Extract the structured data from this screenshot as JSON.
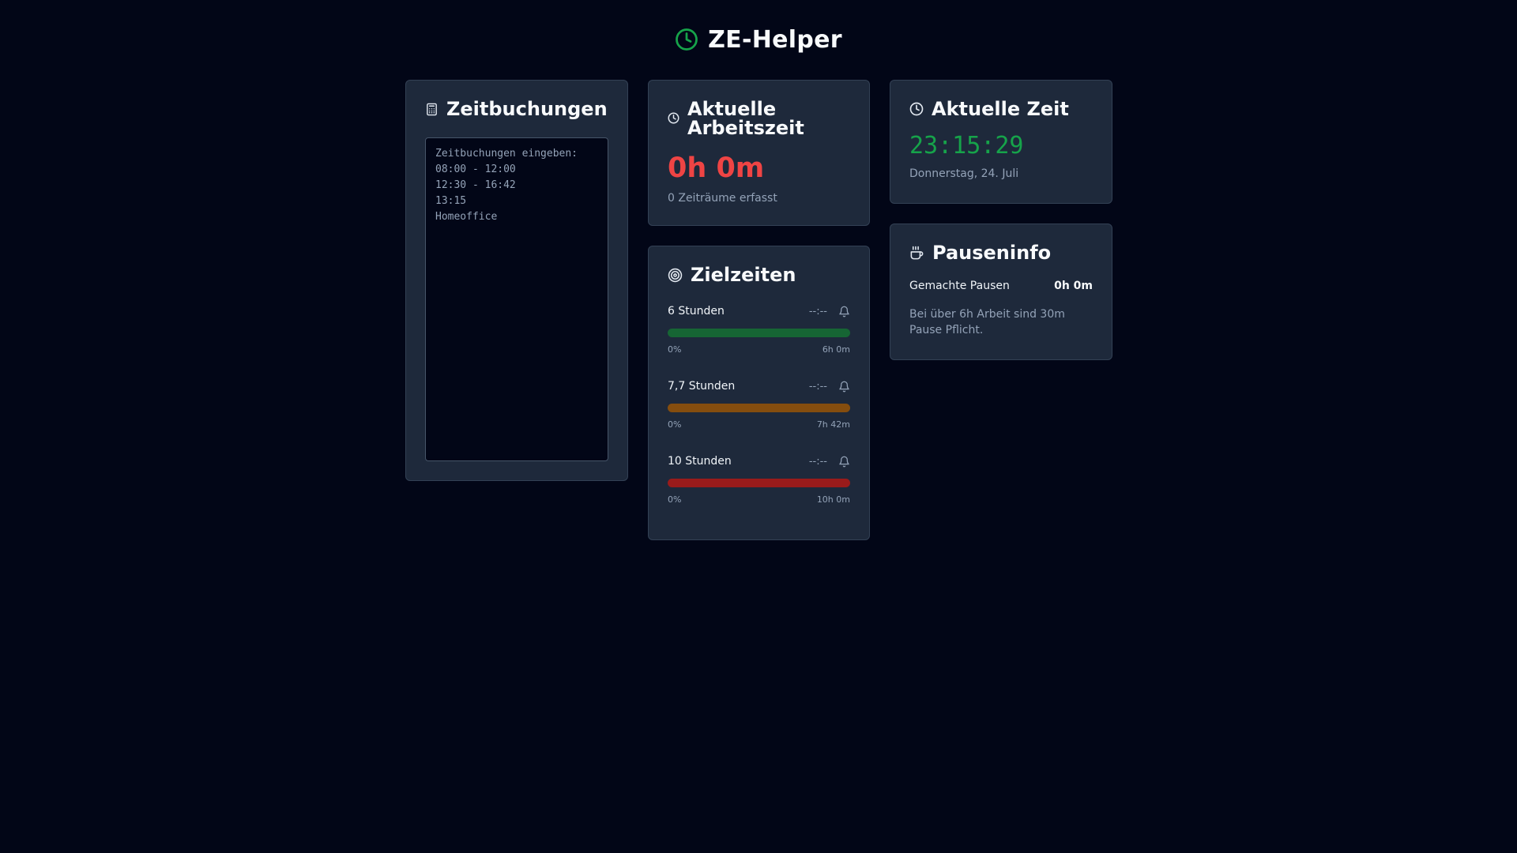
{
  "app": {
    "title": "ZE-Helper",
    "logo_icon": "clock-icon",
    "accent": "#16a34a"
  },
  "bookings": {
    "title": "Zeitbuchungen",
    "icon": "calculator-icon",
    "placeholder": "Zeitbuchungen eingeben:\n08:00 - 12:00\n12:30 - 16:42\n13:15\nHomeoffice",
    "value": ""
  },
  "worktime": {
    "title": "Aktuelle Arbeitszeit",
    "icon": "clock-icon",
    "value": "0h 0m",
    "subtitle": "0 Zeiträume erfasst",
    "value_color": "#ef4444"
  },
  "targets": {
    "title": "Zielzeiten",
    "icon": "target-icon",
    "items": [
      {
        "label": "6 Stunden",
        "time": "--:--",
        "icon": "bell-icon",
        "progress_label": "0%",
        "target_label": "6h 0m",
        "progress": 0,
        "color": "#15803d",
        "track_color": "#166534"
      },
      {
        "label": "7,7 Stunden",
        "time": "--:--",
        "icon": "bell-icon",
        "progress_label": "0%",
        "target_label": "7h 42m",
        "progress": 0,
        "color": "#a16207",
        "track_color": "#854d0e"
      },
      {
        "label": "10 Stunden",
        "time": "--:--",
        "icon": "bell-icon",
        "progress_label": "0%",
        "target_label": "10h 0m",
        "progress": 0,
        "color": "#b91c1c",
        "track_color": "#991b1b"
      }
    ]
  },
  "clock": {
    "title": "Aktuelle Zeit",
    "icon": "clock-icon",
    "time": "23:15:29",
    "date": "Donnerstag, 24. Juli"
  },
  "pause": {
    "title": "Pauseninfo",
    "icon": "coffee-icon",
    "label": "Gemachte Pausen",
    "value": "0h 0m",
    "note": "Bei über 6h Arbeit sind 30m Pause Pflicht."
  }
}
